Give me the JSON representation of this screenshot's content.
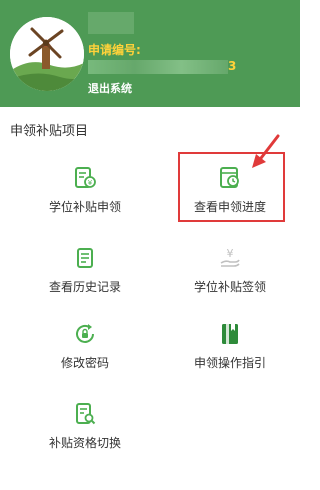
{
  "header": {
    "application_label": "申请编号:",
    "application_number_suffix": "3",
    "logout_label": "退出系统"
  },
  "section": {
    "title": "申领补贴项目"
  },
  "menu": {
    "items": [
      {
        "label": "学位补贴申领",
        "icon": "subsidy-apply-icon"
      },
      {
        "label": "查看申领进度",
        "icon": "progress-clock-icon"
      },
      {
        "label": "查看历史记录",
        "icon": "history-record-icon"
      },
      {
        "label": "学位补贴签领",
        "icon": "yuan-hand-icon"
      },
      {
        "label": "修改密码",
        "icon": "lock-refresh-icon"
      },
      {
        "label": "申领操作指引",
        "icon": "guide-book-icon"
      },
      {
        "label": "补贴资格切换",
        "icon": "doc-search-icon"
      }
    ]
  },
  "colors": {
    "header_bg": "#4e9a55",
    "accent_green": "#4caf50",
    "label_yellow": "#ffd23a",
    "highlight_red": "#e03a3a",
    "icon_gray": "#c0c0c0"
  }
}
